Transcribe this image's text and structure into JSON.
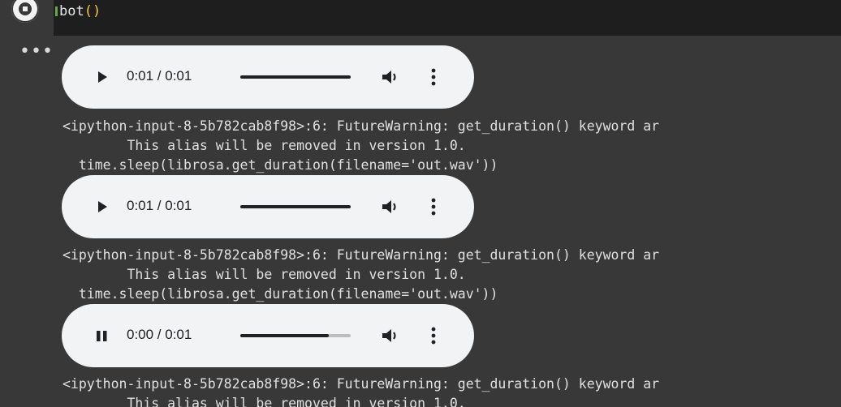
{
  "code_cell": {
    "code_func": "bot",
    "code_parens": "()"
  },
  "output": {
    "menu_glyph": "•••",
    "players": [
      {
        "state": "paused",
        "time": "0:01 / 0:01",
        "progress": 1.0
      },
      {
        "state": "paused",
        "time": "0:01 / 0:01",
        "progress": 1.0
      },
      {
        "state": "playing",
        "time": "0:00 / 0:01",
        "progress": 0.8
      }
    ],
    "warnings": [
      {
        "line1": "<ipython-input-8-5b782cab8f98>:6: FutureWarning: get_duration() keyword ar",
        "line2": "        This alias will be removed in version 1.0.",
        "line3": "  time.sleep(librosa.get_duration(filename='out.wav'))"
      },
      {
        "line1": "<ipython-input-8-5b782cab8f98>:6: FutureWarning: get_duration() keyword ar",
        "line2": "        This alias will be removed in version 1.0.",
        "line3": "  time.sleep(librosa.get_duration(filename='out.wav'))"
      },
      {
        "line1": "<ipython-input-8-5b782cab8f98>:6: FutureWarning: get_duration() keyword ar",
        "line2": "        This alias will be removed in version 1.0.",
        "line3": ""
      }
    ]
  },
  "colors": {
    "background": "#383838",
    "editor_background": "#1e1e1e",
    "player_background": "#f1f3f4",
    "paren_color": "#f6c544"
  },
  "icons": {
    "run": "run-cell-icon",
    "play": "play-icon",
    "pause": "pause-icon",
    "volume": "volume-icon",
    "more": "more-vert-icon",
    "output_menu": "more-horiz-icon"
  }
}
